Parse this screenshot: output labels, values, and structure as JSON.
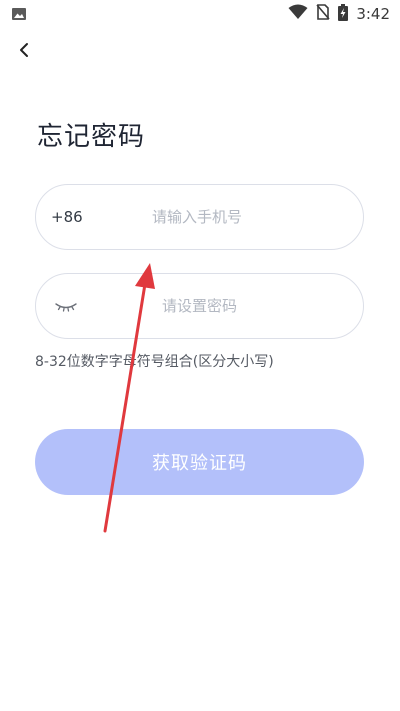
{
  "status_bar": {
    "time": "3:42",
    "icons": [
      "gallery-icon",
      "wifi-icon",
      "no-sim-icon",
      "battery-charging-icon"
    ]
  },
  "header": {
    "back_icon": "chevron-left-icon"
  },
  "page": {
    "title": "忘记密码"
  },
  "phone_field": {
    "country_code": "+86",
    "placeholder": "请输入手机号",
    "value": ""
  },
  "password_field": {
    "visibility_icon": "eye-closed-icon",
    "placeholder": "请设置密码",
    "value": ""
  },
  "password_hint": "8-32位数字字母符号组合(区分大小写)",
  "submit": {
    "label": "获取验证码"
  },
  "colors": {
    "button_bg": "#b3c0fa",
    "title_text": "#1f2533",
    "placeholder_text": "#b3b8c2",
    "field_border": "#dcdfe8",
    "annotation_arrow": "#e0393e"
  }
}
